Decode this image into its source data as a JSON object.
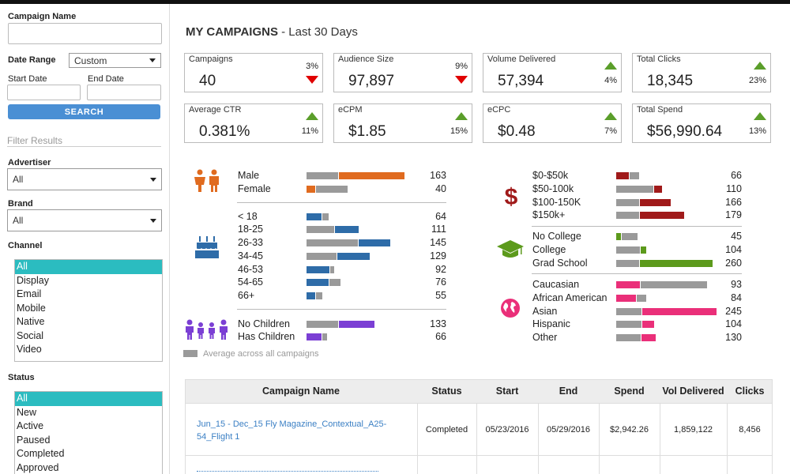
{
  "sidebar": {
    "campaign_name_label": "Campaign Name",
    "campaign_name_value": "",
    "date_range_label": "Date Range",
    "date_range_value": "Custom",
    "start_date_label": "Start Date",
    "end_date_label": "End Date",
    "search_label": "SEARCH",
    "filter_results_label": "Filter Results",
    "advertiser_label": "Advertiser",
    "advertiser_value": "All",
    "brand_label": "Brand",
    "brand_value": "All",
    "channel_label": "Channel",
    "channel_options": [
      "All",
      "Display",
      "Email",
      "Mobile",
      "Native",
      "Social",
      "Video"
    ],
    "channel_selected": "All",
    "status_label": "Status",
    "status_options": [
      "All",
      "New",
      "Active",
      "Paused",
      "Completed",
      "Approved"
    ],
    "status_selected": "All"
  },
  "header": {
    "title": "MY CAMPAIGNS",
    "subtitle": " - Last 30 Days"
  },
  "kpis": [
    {
      "label": "Campaigns",
      "value": "40",
      "change": "3%",
      "direction": "down"
    },
    {
      "label": "Audience Size",
      "value": "97,897",
      "change": "9%",
      "direction": "down"
    },
    {
      "label": "Volume Delivered",
      "value": "57,394",
      "change": "4%",
      "direction": "up"
    },
    {
      "label": "Total Clicks",
      "value": "18,345",
      "change": "23%",
      "direction": "up"
    },
    {
      "label": "Average CTR",
      "value": "0.381%",
      "change": "11%",
      "direction": "up"
    },
    {
      "label": "eCPM",
      "value": "$1.85",
      "change": "15%",
      "direction": "up"
    },
    {
      "label": "eCPC",
      "value": "$0.48",
      "change": "7%",
      "direction": "up"
    },
    {
      "label": "Total Spend",
      "value": "$56,990.64",
      "change": "13%",
      "direction": "up"
    }
  ],
  "colors": {
    "gender": "#e06b1f",
    "age": "#2e6ca8",
    "children": "#7b3fd4",
    "income": "#a01a1a",
    "education": "#5c9a1c",
    "ethnicity": "#ea2f79",
    "average": "#9a9a9a",
    "up": "#5a9e2a",
    "down": "#e00000",
    "selected": "#2bbcc0",
    "button": "#4a8fd4",
    "link": "#3a7fc4"
  },
  "demographics": {
    "gender": [
      {
        "label": "Male",
        "value": "163"
      },
      {
        "label": "Female",
        "value": "40"
      }
    ],
    "age": [
      {
        "label": "< 18",
        "value": "64"
      },
      {
        "label": "18-25",
        "value": "111"
      },
      {
        "label": "26-33",
        "value": "145"
      },
      {
        "label": "34-45",
        "value": "129"
      },
      {
        "label": "46-53",
        "value": "92"
      },
      {
        "label": "54-65",
        "value": "76"
      },
      {
        "label": "66+",
        "value": "55"
      }
    ],
    "children": [
      {
        "label": "No Children",
        "value": "133"
      },
      {
        "label": "Has Children",
        "value": "66"
      }
    ],
    "income": [
      {
        "label": "$0-$50k",
        "value": "66"
      },
      {
        "label": "$50-100k",
        "value": "110"
      },
      {
        "label": "$100-150K",
        "value": "166"
      },
      {
        "label": "$150k+",
        "value": "179"
      }
    ],
    "education": [
      {
        "label": "No College",
        "value": "45"
      },
      {
        "label": "College",
        "value": "104"
      },
      {
        "label": "Grad School",
        "value": "260"
      }
    ],
    "ethnicity": [
      {
        "label": "Caucasian",
        "value": "93"
      },
      {
        "label": "African American",
        "value": "84"
      },
      {
        "label": "Asian",
        "value": "245"
      },
      {
        "label": "Hispanic",
        "value": "104"
      },
      {
        "label": "Other",
        "value": "130"
      }
    ],
    "legend_label": "Average across all campaigns"
  },
  "table": {
    "columns": [
      "Campaign Name",
      "Status",
      "Start",
      "End",
      "Spend",
      "Vol Delivered",
      "Clicks"
    ],
    "rows": [
      {
        "name_line1": "Jun_15 - Dec_15 Fly Magazine_Contextual_A25-",
        "name_line2": "54_Flight 1",
        "status": "Completed",
        "start": "05/23/2016",
        "end": "05/29/2016",
        "spend": "$2,942.26",
        "vol": "1,859,122",
        "clicks": "8,456"
      }
    ]
  }
}
